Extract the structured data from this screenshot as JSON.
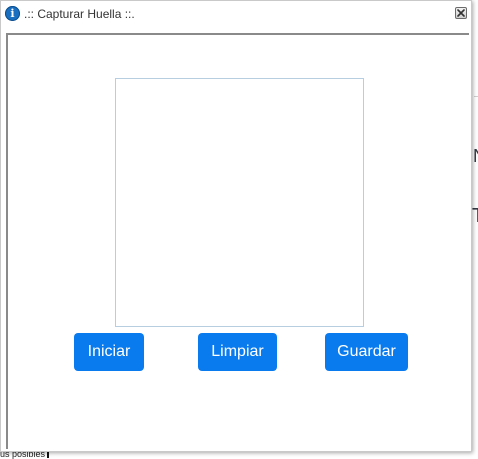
{
  "background": {
    "footer_text": "us posibles",
    "glyph_n": "N",
    "glyph_t": "T"
  },
  "dialog": {
    "title": ".:: Capturar Huella ::.",
    "title_icon": "info-icon",
    "close_icon": "close-icon"
  },
  "buttons": {
    "start_label": "Iniciar",
    "clear_label": "Limpiar",
    "save_label": "Guardar"
  },
  "colors": {
    "button_primary": "#0a7bef",
    "capture_border": "#b7cde0",
    "info_icon": "#1a6fc0"
  }
}
